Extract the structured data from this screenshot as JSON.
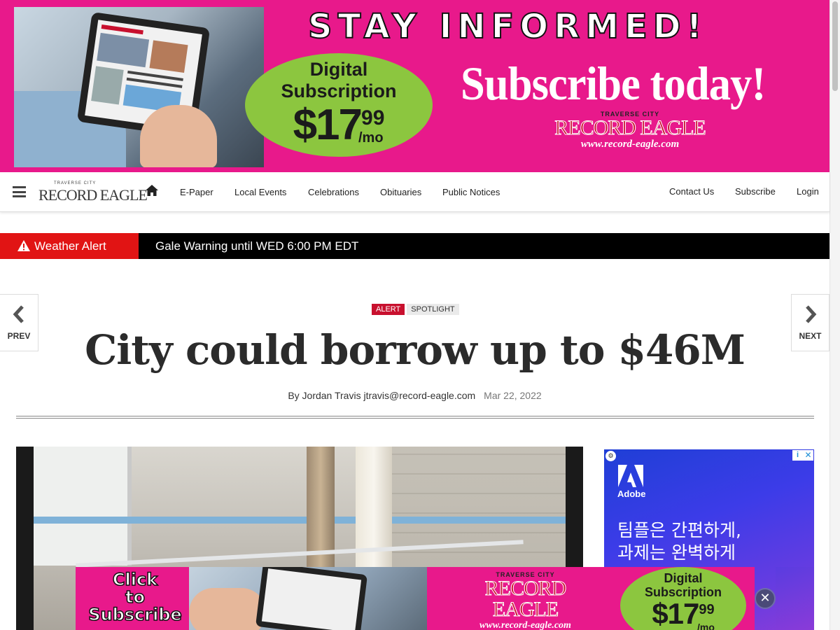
{
  "top_banner": {
    "headline": "STAY INFORMED!",
    "offer_line1": "Digital",
    "offer_line2": "Subscription",
    "price_dollars": "$17",
    "price_cents": "99",
    "price_period": "/mo",
    "cta": "Subscribe today!",
    "logo_small": "TRAVERSE CITY",
    "logo_name": "RECORD EAGLE",
    "logo_url": "www.record-eagle.com"
  },
  "nav": {
    "logo_small": "TRAVERSE CITY",
    "logo_name": "RECORD EAGLE",
    "items": [
      "E-Paper",
      "Local Events",
      "Celebrations",
      "Obituaries",
      "Public Notices"
    ],
    "right_items": [
      "Contact Us",
      "Subscribe",
      "Login"
    ]
  },
  "weather_alert": {
    "label": "Weather Alert",
    "message": "Gale Warning until WED 6:00 PM EDT"
  },
  "pager": {
    "prev": "PREV",
    "next": "NEXT"
  },
  "article": {
    "badges": [
      "ALERT",
      "SPOTLIGHT"
    ],
    "headline": "City could borrow up to $46M",
    "byline": "By Jordan Travis jtravis@record-eagle.com",
    "date": "Mar 22, 2022"
  },
  "side_ad": {
    "brand": "Adobe",
    "line1": "팀플은 간편하게,",
    "line2": "과제는 완벽하게"
  },
  "sticky_ad": {
    "click_l1": "Click",
    "click_l2": "to",
    "click_l3": "Subscribe",
    "logo_small": "TRAVERSE CITY",
    "logo_name": "RECORD EAGLE",
    "logo_url": "www.record-eagle.com",
    "offer_line1": "Digital",
    "offer_line2": "Subscription",
    "price_dollars": "$17",
    "price_cents": "99",
    "price_period": "/mo"
  },
  "colors": {
    "banner_pink": "#e8198b",
    "offer_green": "#8cc63f",
    "alert_red": "#e11414",
    "brand_red": "#c8102e"
  }
}
